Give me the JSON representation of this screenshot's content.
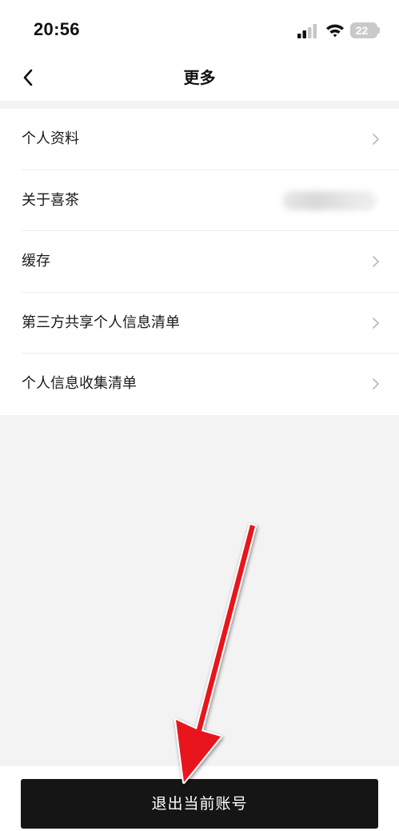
{
  "status_bar": {
    "time": "20:56",
    "battery": "22",
    "signal_icon": "cellular-signal-icon",
    "wifi_icon": "wifi-icon"
  },
  "nav": {
    "title": "更多",
    "back_icon": "chevron-left-icon"
  },
  "menu": {
    "items": [
      {
        "label": "个人资料",
        "icon": "chevron-right-icon"
      },
      {
        "label": "关于喜茶",
        "icon": "none"
      },
      {
        "label": "缓存",
        "icon": "chevron-right-icon"
      },
      {
        "label": "第三方共享个人信息清单",
        "icon": "chevron-right-icon"
      },
      {
        "label": "个人信息收集清单",
        "icon": "chevron-right-icon"
      }
    ]
  },
  "logout": {
    "label": "退出当前账号"
  },
  "colors": {
    "page_background": "#f3f3f3",
    "button_background": "#151515",
    "annotation_arrow": "#e8141b"
  }
}
